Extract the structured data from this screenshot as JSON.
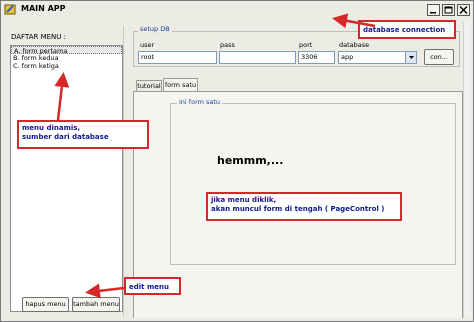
{
  "window": {
    "title": "MAIN APP",
    "icons": {
      "app": "app-icon",
      "minimize": "minimize-icon",
      "maximize": "maximize-icon",
      "close": "close-icon"
    }
  },
  "left_panel": {
    "menu_label": "DAFTAR MENU :",
    "menu_items": [
      "A. form pertama",
      "B. form kedua",
      "C. form ketiga"
    ],
    "selected_index": 0,
    "buttons": {
      "hapus": "hapus menu",
      "tambah": "tambah menu"
    }
  },
  "setup_db": {
    "legend": "setup DB",
    "fields": {
      "user": {
        "label": "user",
        "value": "root"
      },
      "pass": {
        "label": "pass",
        "value": ""
      },
      "port": {
        "label": "port",
        "value": "3306"
      },
      "database": {
        "label": "database",
        "value": "app"
      }
    },
    "connect_label": "con..."
  },
  "tabs": {
    "tutorial": "tutorial",
    "form_satu": "form satu",
    "active": "form satu"
  },
  "tab_content": {
    "legend": "ini form satu",
    "message": "hemmm,..."
  },
  "annotations": {
    "db_connection": "database connection",
    "menu_dinamis": [
      "menu dinamis,",
      "sumber dari database"
    ],
    "edit_menu": "edit menu",
    "form_note": [
      "jika menu diklik,",
      "akan muncul form di tengah ( PageControl )"
    ]
  },
  "colors": {
    "annotation_border": "#d62828",
    "annotation_text": "#0d1b8e",
    "legend_text": "#1c3fa0",
    "window_bg": "#ecebe4"
  }
}
